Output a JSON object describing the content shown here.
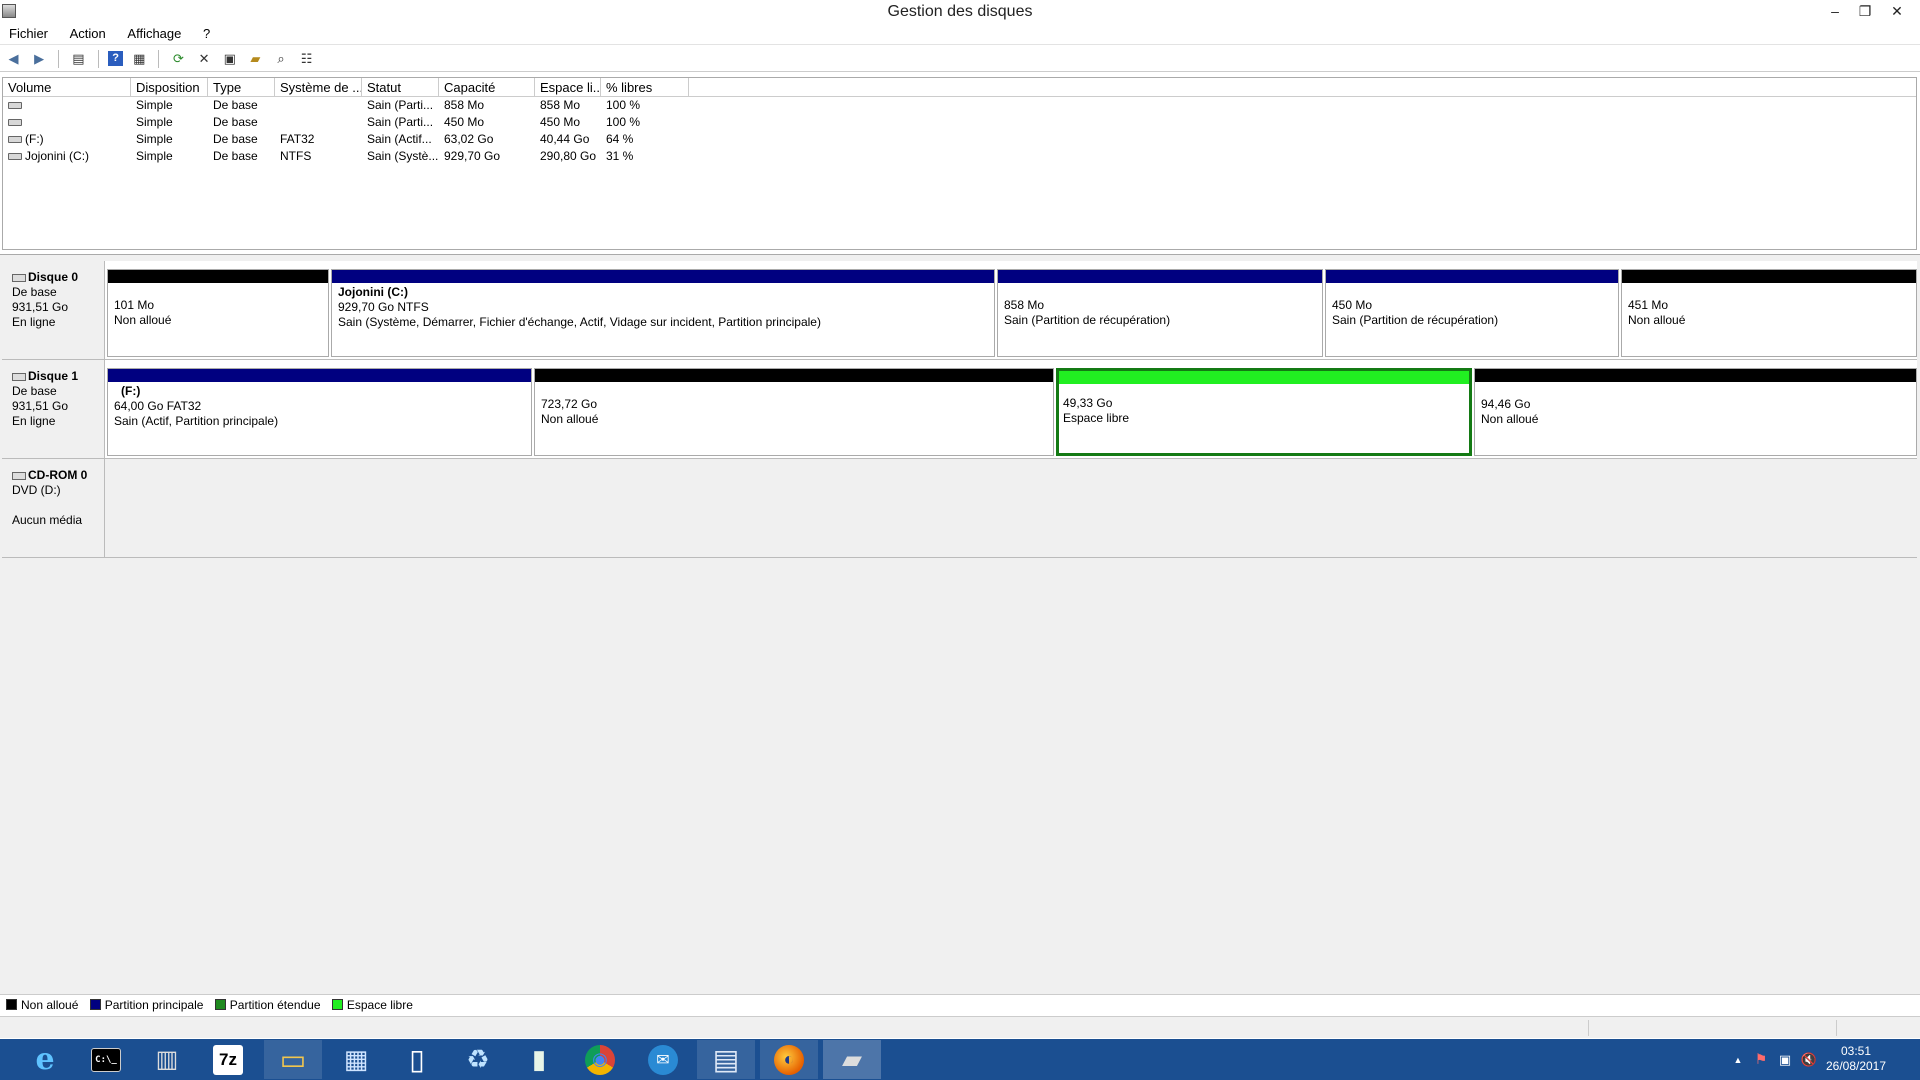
{
  "window": {
    "title": "Gestion des disques",
    "controls": {
      "minimize": "–",
      "restore": "❐",
      "close": "✕"
    }
  },
  "menu": [
    "Fichier",
    "Action",
    "Affichage",
    "?"
  ],
  "toolbar": {
    "icons": [
      "back-arrow-icon",
      "forward-arrow-icon",
      "console-tree-icon",
      "help-icon",
      "properties-pane-icon",
      "refresh-icon",
      "delete-icon",
      "properties-icon",
      "open-icon",
      "search-icon",
      "settings-icon"
    ]
  },
  "volume_list": {
    "columns": [
      "Volume",
      "Disposition",
      "Type",
      "Système de ...",
      "Statut",
      "Capacité",
      "Espace li...",
      "% libres"
    ],
    "rows": [
      {
        "volume": "",
        "layout": "Simple",
        "type": "De base",
        "fs": "",
        "status": "Sain (Parti...",
        "capacity": "858 Mo",
        "free": "858 Mo",
        "pct": "100 %"
      },
      {
        "volume": "",
        "layout": "Simple",
        "type": "De base",
        "fs": "",
        "status": "Sain (Parti...",
        "capacity": "450 Mo",
        "free": "450 Mo",
        "pct": "100 %"
      },
      {
        "volume": "(F:)",
        "layout": "Simple",
        "type": "De base",
        "fs": "FAT32",
        "status": "Sain (Actif...",
        "capacity": "63,02 Go",
        "free": "40,44 Go",
        "pct": "64 %"
      },
      {
        "volume": "Jojonini (C:)",
        "layout": "Simple",
        "type": "De base",
        "fs": "NTFS",
        "status": "Sain (Systè...",
        "capacity": "929,70 Go",
        "free": "290,80 Go",
        "pct": "31 %"
      }
    ]
  },
  "disks": [
    {
      "name": "Disque 0",
      "type": "De base",
      "size": "931,51 Go",
      "state": "En ligne",
      "partitions": [
        {
          "name": "",
          "line1": "101 Mo",
          "line2": "Non alloué",
          "kind": "unallocated"
        },
        {
          "name": "Jojonini  (C:)",
          "line1": "929,70 Go NTFS",
          "line2": "Sain (Système, Démarrer, Fichier d'échange, Actif, Vidage sur incident, Partition principale)",
          "kind": "primary"
        },
        {
          "name": "",
          "line1": "858 Mo",
          "line2": "Sain (Partition de récupération)",
          "kind": "primary"
        },
        {
          "name": "",
          "line1": "450 Mo",
          "line2": "Sain (Partition de récupération)",
          "kind": "primary"
        },
        {
          "name": "",
          "line1": "451 Mo",
          "line2": "Non alloué",
          "kind": "unallocated"
        }
      ]
    },
    {
      "name": "Disque 1",
      "type": "De base",
      "size": "931,51 Go",
      "state": "En ligne",
      "partitions": [
        {
          "name": "(F:)",
          "line1": "64,00 Go FAT32",
          "line2": "Sain (Actif, Partition principale)",
          "kind": "primary"
        },
        {
          "name": "",
          "line1": "723,72 Go",
          "line2": "Non alloué",
          "kind": "unallocated"
        },
        {
          "name": "",
          "line1": "49,33 Go",
          "line2": "Espace libre",
          "kind": "free",
          "selected": true
        },
        {
          "name": "",
          "line1": "94,46 Go",
          "line2": "Non alloué",
          "kind": "unallocated"
        }
      ]
    }
  ],
  "cdrom": {
    "name": "CD-ROM 0",
    "drive": "DVD (D:)",
    "media": "Aucun média"
  },
  "legend": [
    {
      "label": "Non alloué",
      "color": "#000000"
    },
    {
      "label": "Partition principale",
      "color": "#000080"
    },
    {
      "label": "Partition étendue",
      "color": "#1f8a1f"
    },
    {
      "label": "Espace libre",
      "color": "#21ef21"
    }
  ],
  "colors": {
    "unallocated": "#000000",
    "primary": "#000080",
    "free": "#21ef21",
    "selected_border": "#147a14",
    "taskbar": "#1b4f91"
  },
  "taskbar": {
    "apps": [
      {
        "icon": "internet-explorer-icon",
        "glyph": "e"
      },
      {
        "icon": "command-prompt-icon",
        "glyph": "C:\\_"
      },
      {
        "icon": "tools-icon",
        "glyph": "▥"
      },
      {
        "icon": "7zip-icon",
        "glyph": "7z"
      },
      {
        "icon": "file-explorer-icon",
        "glyph": "▭"
      },
      {
        "icon": "control-panel-icon",
        "glyph": "▦"
      },
      {
        "icon": "document-icon",
        "glyph": "▯"
      },
      {
        "icon": "recycle-bin-icon",
        "glyph": "♻"
      },
      {
        "icon": "file-icon",
        "glyph": "▮"
      },
      {
        "icon": "chrome-icon",
        "glyph": "◉"
      },
      {
        "icon": "thunderbird-icon",
        "glyph": "✉"
      },
      {
        "icon": "calculator-icon",
        "glyph": "▤"
      },
      {
        "icon": "firefox-icon",
        "glyph": "◐"
      },
      {
        "icon": "disk-management-icon",
        "glyph": "▰"
      }
    ],
    "tray": {
      "arrow": "▲",
      "flag": "⚑",
      "network": "▣",
      "volume": "🔇"
    },
    "time": "03:51",
    "date": "26/08/2017"
  }
}
